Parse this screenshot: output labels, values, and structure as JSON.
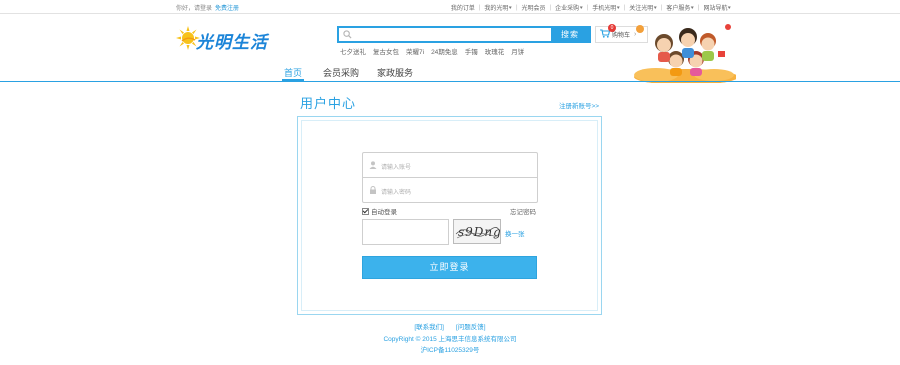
{
  "topbar": {
    "greeting": "你好，请登录",
    "register": "免费注册",
    "links": [
      {
        "label": "我的订单",
        "dropdown": false
      },
      {
        "label": "我的光明",
        "dropdown": true
      },
      {
        "label": "光明会员",
        "dropdown": false
      },
      {
        "label": "企业采购",
        "dropdown": true
      },
      {
        "label": "手机光明",
        "dropdown": true
      },
      {
        "label": "关注光明",
        "dropdown": true
      },
      {
        "label": "客户服务",
        "dropdown": true
      },
      {
        "label": "网站导航",
        "dropdown": true
      }
    ]
  },
  "header": {
    "logo_text": "光明生活",
    "search": {
      "placeholder": "",
      "value": "",
      "button": "搜索",
      "icon": "search-icon"
    },
    "hotwords": [
      "七夕送礼",
      "复古女包",
      "荣耀7i",
      "24期免息",
      "手镯",
      "玫瑰花",
      "月饼"
    ],
    "cart": {
      "label": "购物车",
      "count": "0",
      "icon": "cart-icon"
    }
  },
  "nav": {
    "items": [
      {
        "label": "首页",
        "active": true
      },
      {
        "label": "会员采购",
        "active": false
      },
      {
        "label": "家政服务",
        "active": false
      }
    ]
  },
  "user_center": {
    "title": "用户中心",
    "register_link": "注册新账号>>",
    "username_placeholder": "请输入账号",
    "password_placeholder": "请输入密码",
    "auto_login": "自动登录",
    "auto_login_checked": true,
    "forgot": "忘记密码",
    "captcha_text": "s9Dng",
    "captcha_refresh": "换一张",
    "login_button": "立即登录"
  },
  "footer": {
    "links": [
      "[联系我们]",
      "[问题反馈]"
    ],
    "copyright": "CopyRight © 2015 上海思丰信息系统有限公司",
    "icp": "沪ICP备11025329号"
  },
  "colors": {
    "accent": "#2aa1e2",
    "button": "#3cb2ec",
    "badge": "#e53935"
  }
}
